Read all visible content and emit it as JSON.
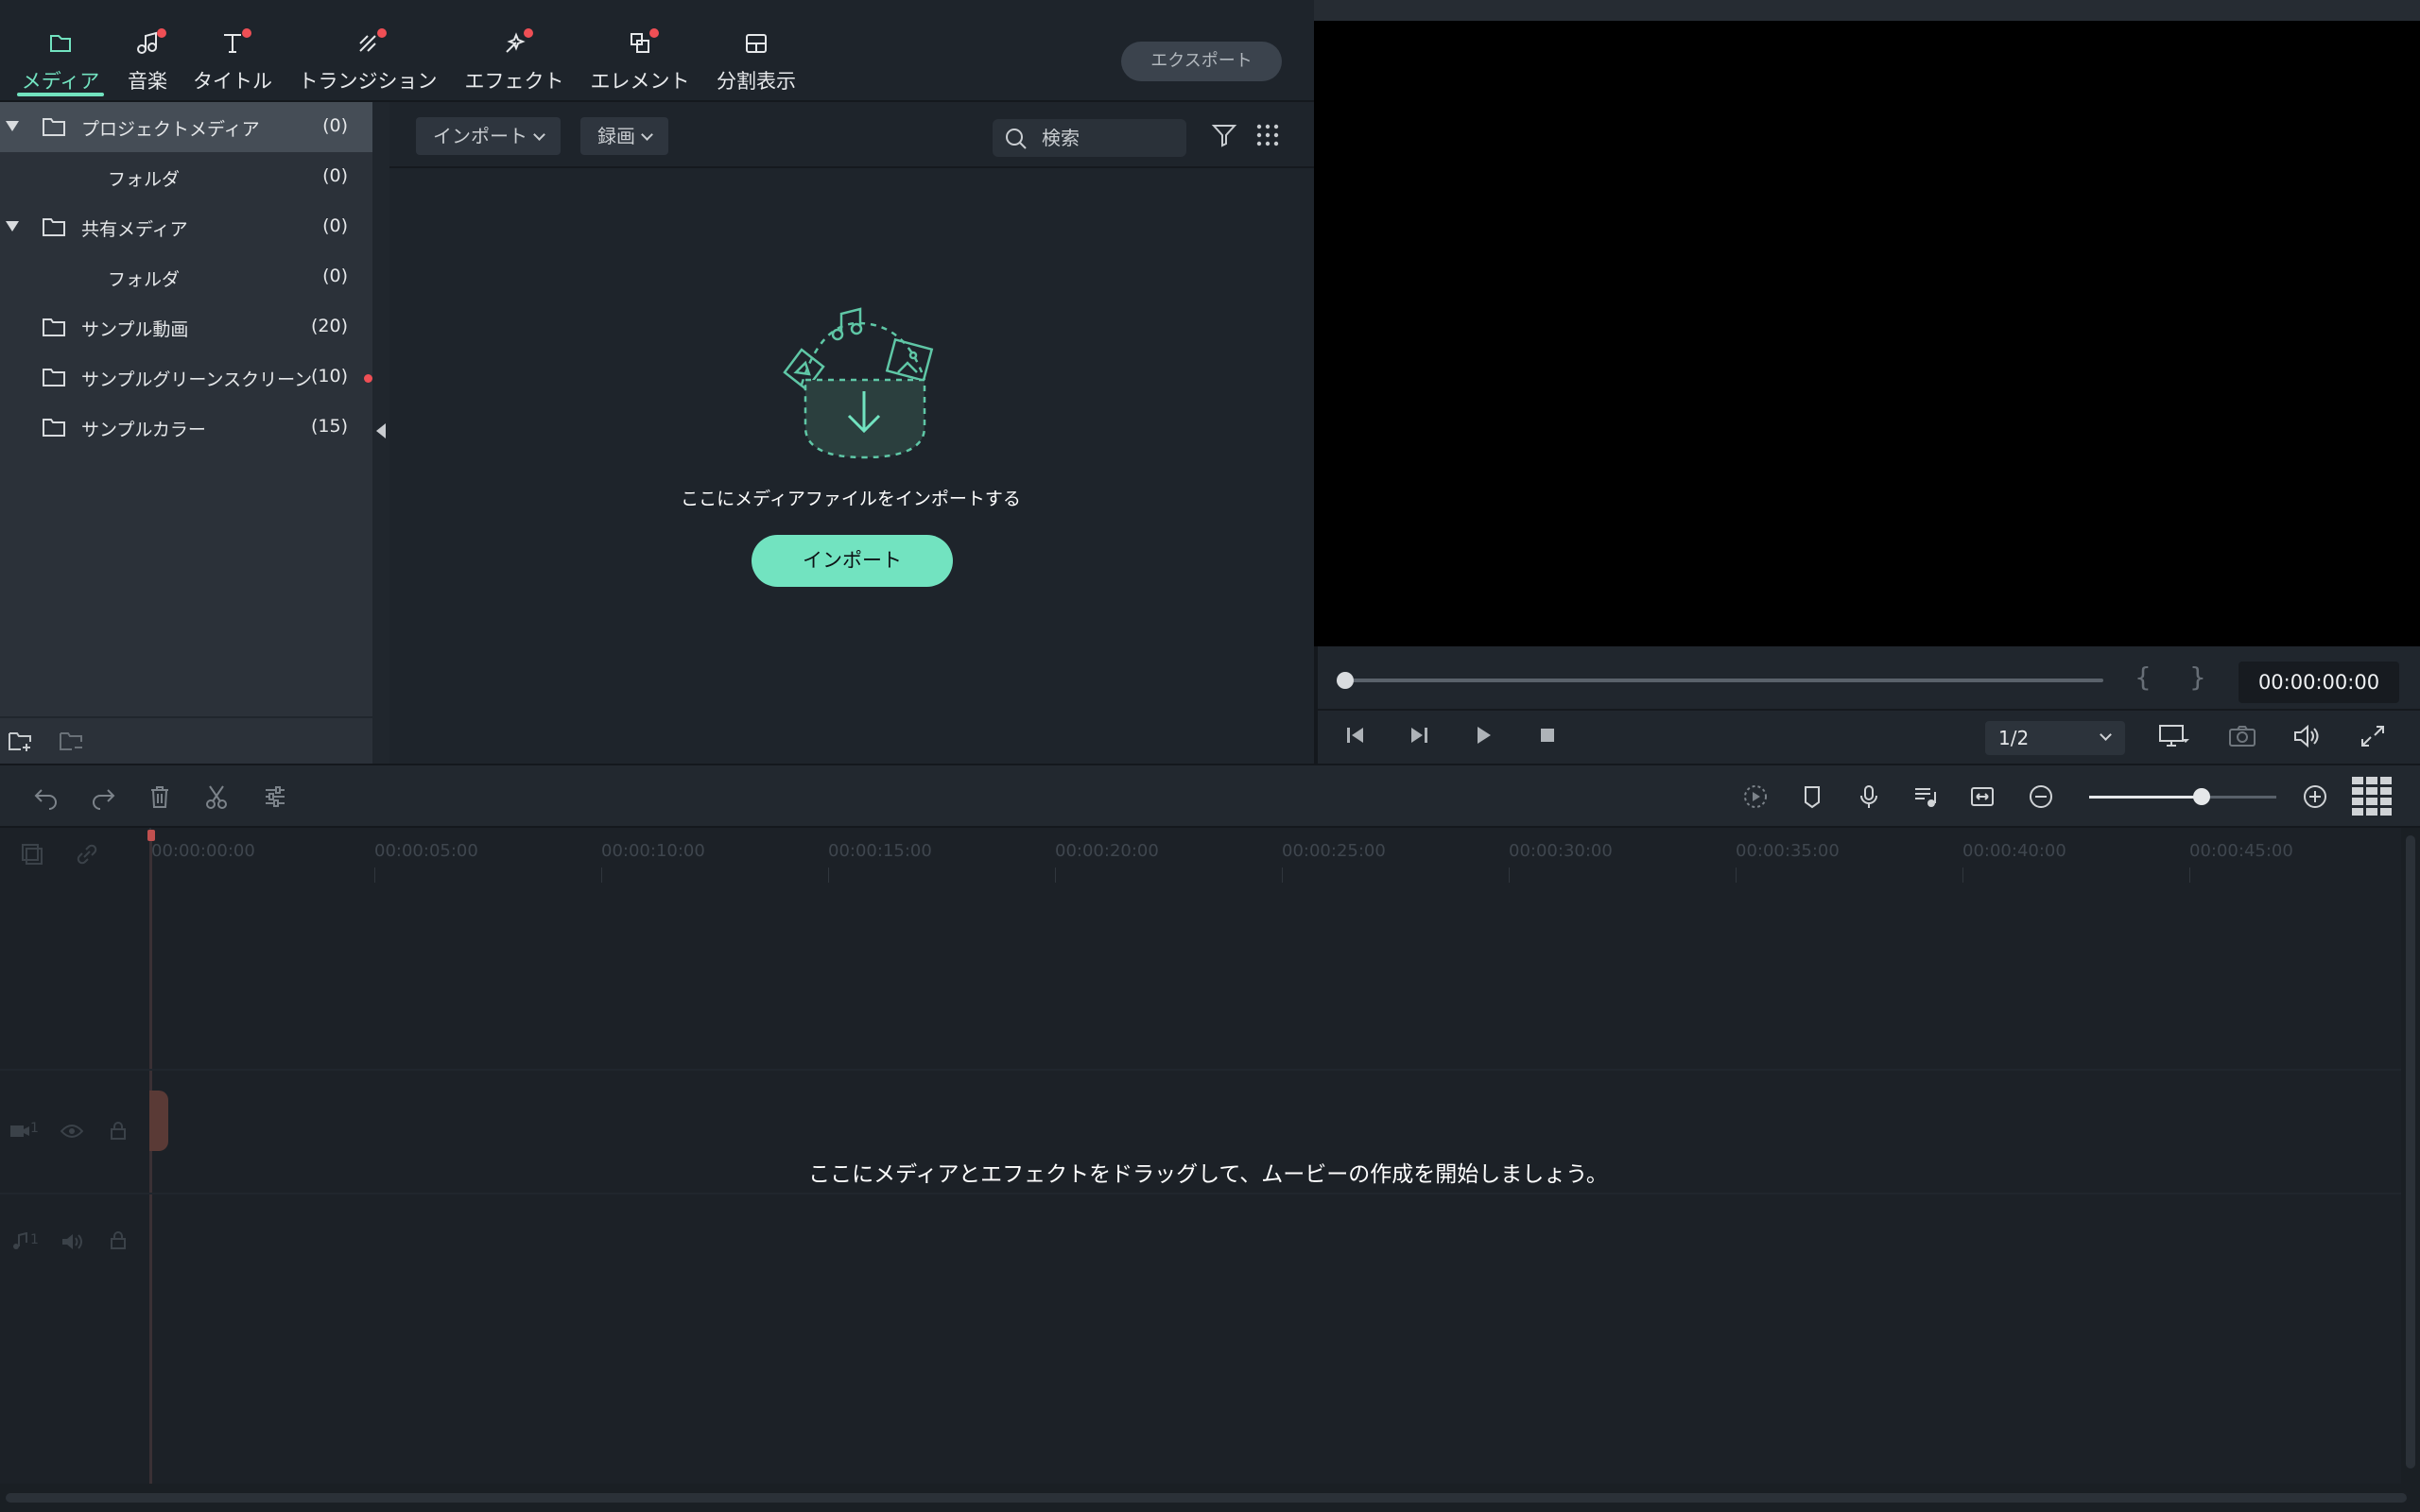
{
  "tabs": [
    {
      "label": "メディア",
      "icon": "folder-icon",
      "active": true,
      "dot": false
    },
    {
      "label": "音楽",
      "icon": "music-icon",
      "active": false,
      "dot": true
    },
    {
      "label": "タイトル",
      "icon": "title-icon",
      "active": false,
      "dot": true
    },
    {
      "label": "トランジション",
      "icon": "transition-icon",
      "active": false,
      "dot": true
    },
    {
      "label": "エフェクト",
      "icon": "effect-icon",
      "active": false,
      "dot": true
    },
    {
      "label": "エレメント",
      "icon": "element-icon",
      "active": false,
      "dot": true
    },
    {
      "label": "分割表示",
      "icon": "split-screen-icon",
      "active": false,
      "dot": false
    }
  ],
  "export_label": "エクスポート",
  "sidebar": {
    "items": [
      {
        "name": "プロジェクトメディア",
        "count": "(0)"
      },
      {
        "name": "フォルダ",
        "count": "(0)"
      },
      {
        "name": "共有メディア",
        "count": "(0)"
      },
      {
        "name": "フォルダ",
        "count": "(0)"
      },
      {
        "name": "サンプル動画",
        "count": "(20)"
      },
      {
        "name": "サンプルグリーンスクリーン",
        "count": "(10)"
      },
      {
        "name": "サンプルカラー",
        "count": "(15)"
      }
    ]
  },
  "media": {
    "import_dropdown": "インポート",
    "record_dropdown": "録画",
    "search_placeholder": "検索",
    "import_hint": "ここにメディアファイルをインポートする",
    "import_button": "インポート"
  },
  "preview": {
    "timecode": "00:00:00:00",
    "open_brace": "{",
    "close_brace": "}",
    "ratio": "1/2"
  },
  "timeline": {
    "ticks": [
      "00:00:00:00",
      "00:00:05:00",
      "00:00:10:00",
      "00:00:15:00",
      "00:00:20:00",
      "00:00:25:00",
      "00:00:30:00",
      "00:00:35:00",
      "00:00:40:00",
      "00:00:45:00"
    ],
    "video_track_num": "1",
    "audio_track_num": "1",
    "zoom_level": 0.6,
    "drop_hint": "ここにメディアとエフェクトをドラッグして、ムービーの作成を開始しましょう。"
  },
  "colors": {
    "accent": "#72e3c0",
    "notify_dot": "#ef4f55",
    "background": "#1d2229",
    "sidebar": "#2b3139"
  }
}
